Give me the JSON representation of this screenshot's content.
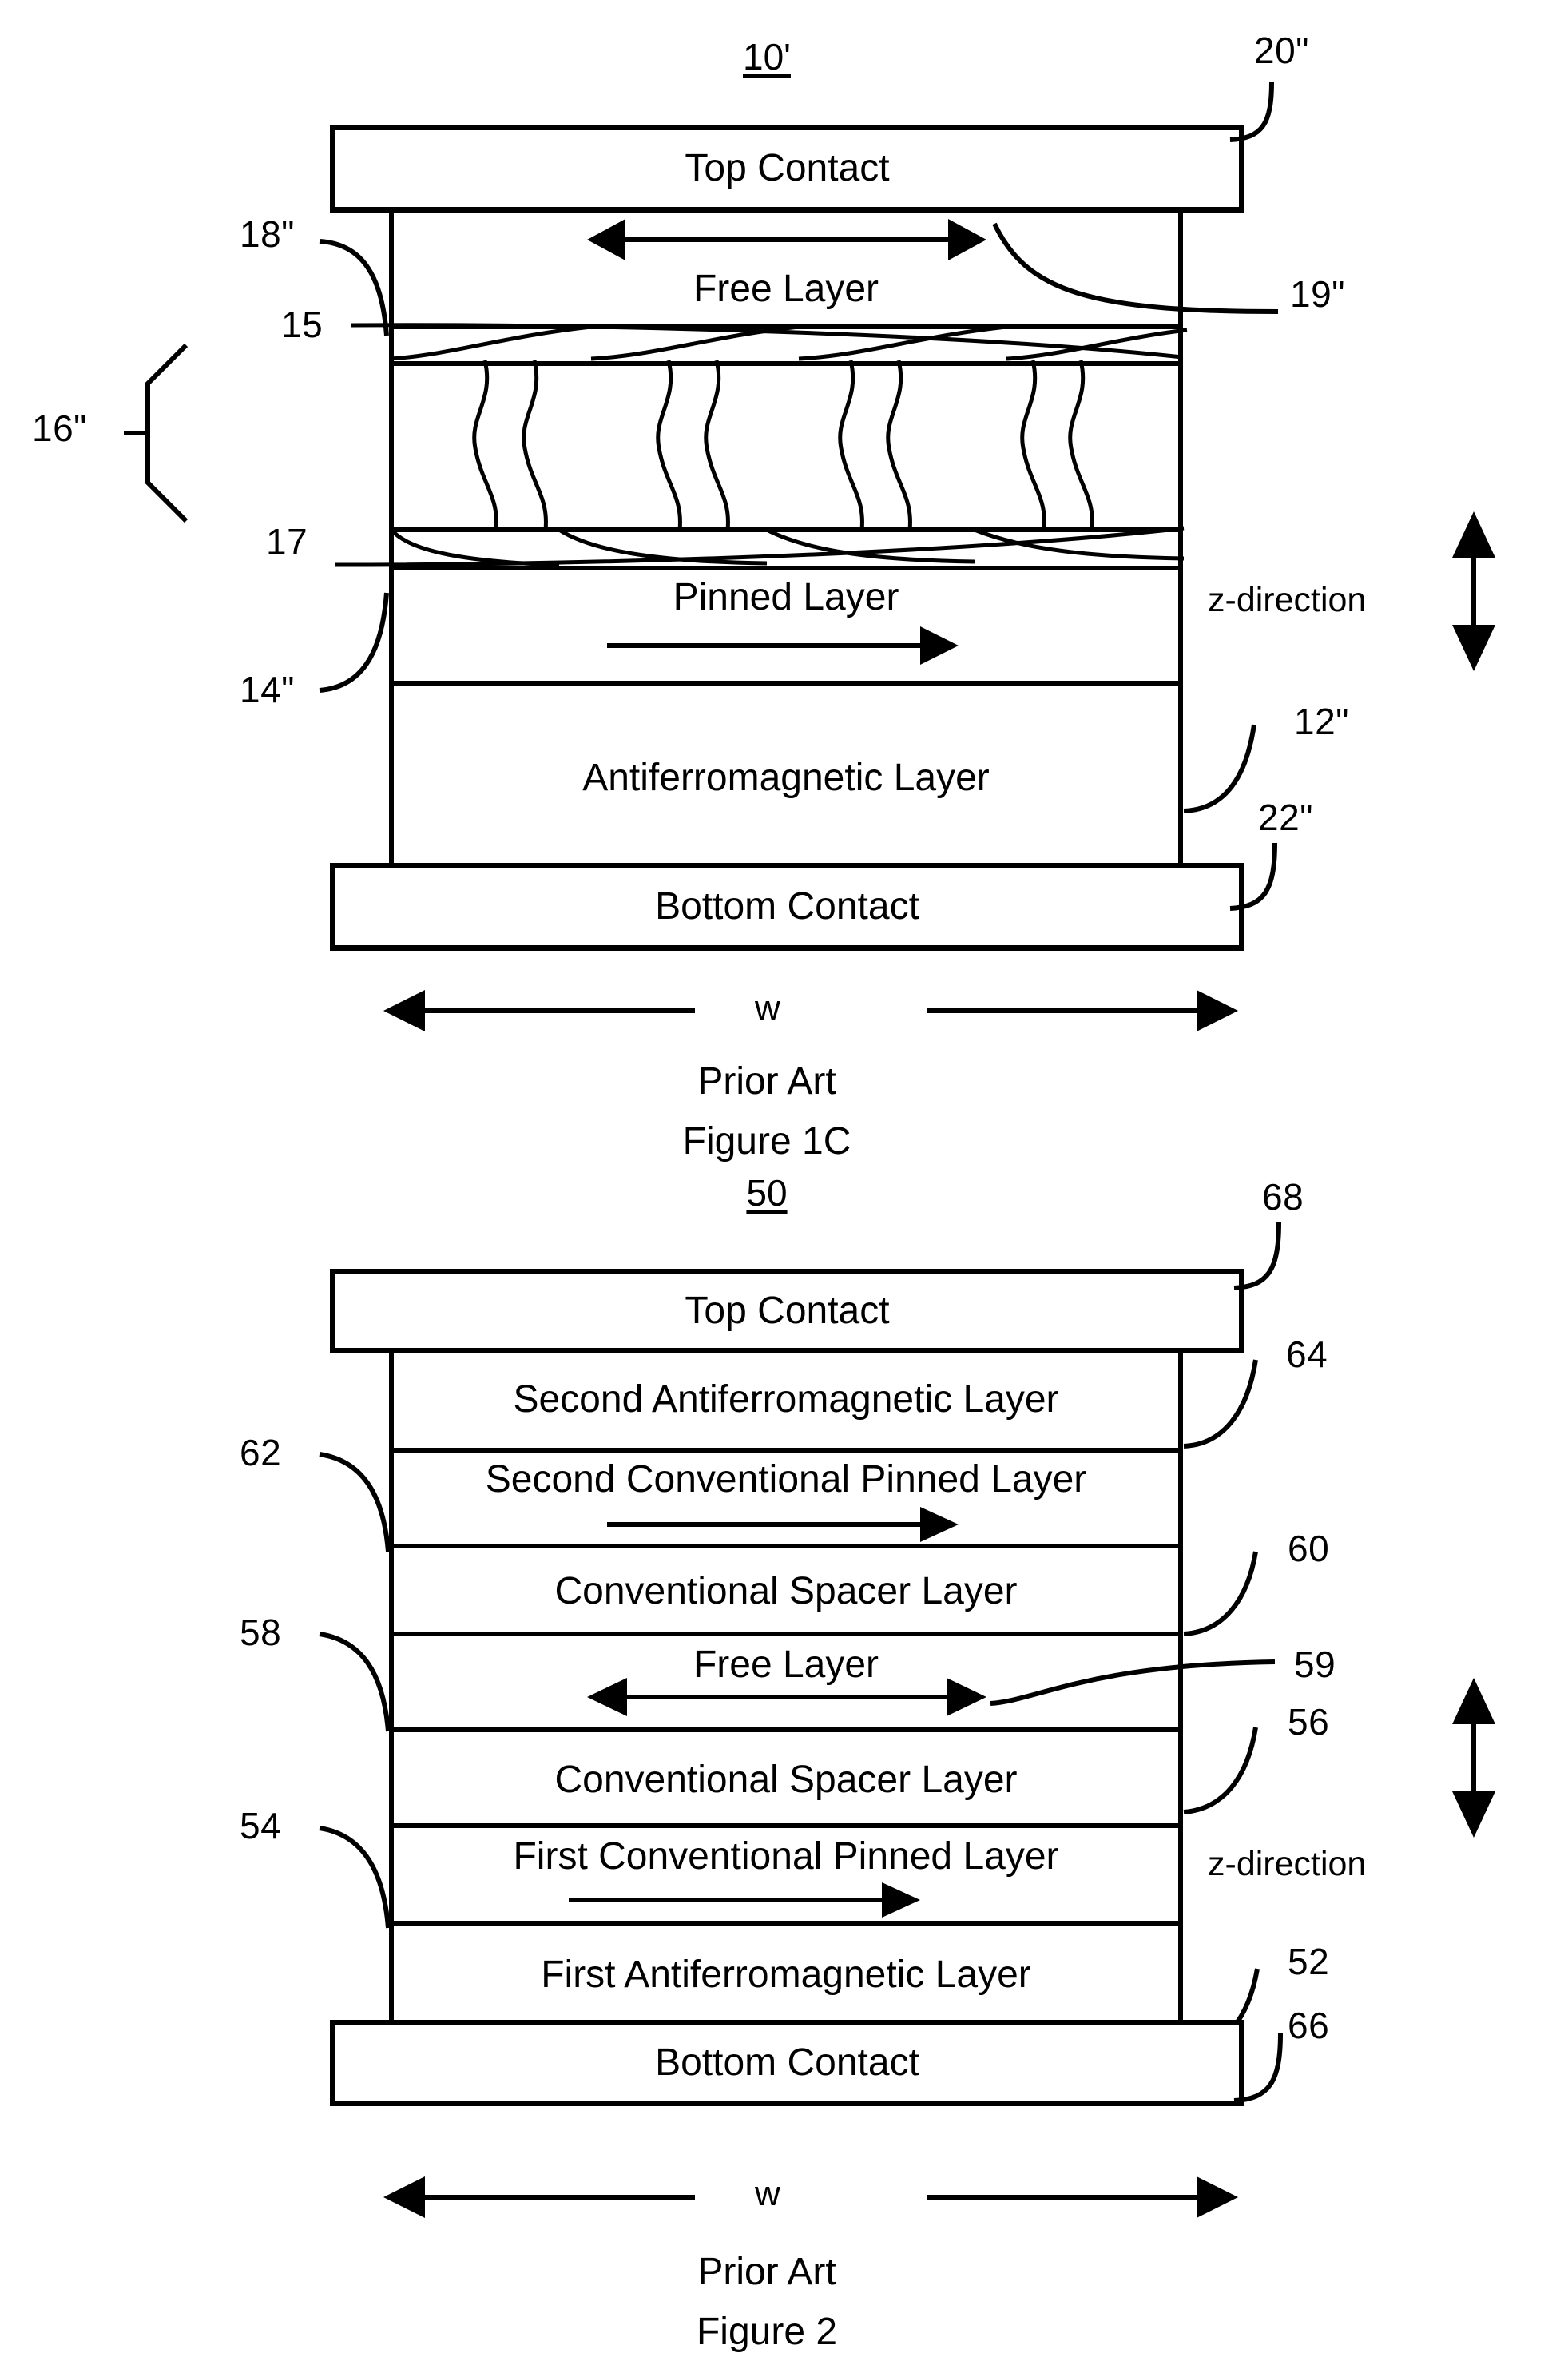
{
  "figures": [
    {
      "id": "figure-1c",
      "label": "10'",
      "prior_art": "Prior Art",
      "caption": "Figure 1C",
      "width_label": "w",
      "z_label": "z-direction",
      "top_contact": "Top Contact",
      "bottom_contact": "Bottom Contact",
      "top_contact_ref": "20\"",
      "bottom_contact_ref": "22\"",
      "layers": [
        {
          "name": "Free Layer",
          "ref": "18\"",
          "arrow": "double"
        },
        {
          "name": "",
          "ref": "15",
          "arrow": "none"
        },
        {
          "name": "",
          "ref": "16\"",
          "arrow": "none"
        },
        {
          "name": "",
          "ref": "17",
          "arrow": "none"
        },
        {
          "name": "Pinned Layer",
          "ref": "14\"",
          "arrow": "right"
        },
        {
          "name": "Antiferromagnetic Layer",
          "ref": "12\"",
          "arrow": "none"
        }
      ],
      "extra_refs": [
        {
          "text": "19\""
        },
        {
          "text": "15"
        },
        {
          "text": "16\""
        },
        {
          "text": "17"
        }
      ]
    },
    {
      "id": "figure-2",
      "label": "50",
      "prior_art": "Prior Art",
      "caption": "Figure 2",
      "width_label": "w",
      "z_label": "z-direction",
      "top_contact": "Top Contact",
      "bottom_contact": "Bottom Contact",
      "top_contact_ref": "68",
      "bottom_contact_ref": "66",
      "layers": [
        {
          "name": "Second Antiferromagnetic Layer",
          "ref": "64",
          "arrow": "none"
        },
        {
          "name": "Second Conventional Pinned Layer",
          "ref": "62",
          "arrow": "right"
        },
        {
          "name": "Conventional Spacer Layer",
          "ref": "60",
          "arrow": "none"
        },
        {
          "name": "Free Layer",
          "ref": "58",
          "arrow": "double"
        },
        {
          "name": "Conventional Spacer Layer",
          "ref": "56",
          "arrow": "none"
        },
        {
          "name": "First Conventional Pinned Layer",
          "ref": "54",
          "arrow": "right"
        },
        {
          "name": "First Antiferromagnetic Layer",
          "ref": "52",
          "arrow": "none"
        }
      ],
      "extra_refs": [
        {
          "text": "59"
        }
      ]
    }
  ],
  "colors": {
    "ink": "#000000",
    "paper": "#ffffff"
  }
}
